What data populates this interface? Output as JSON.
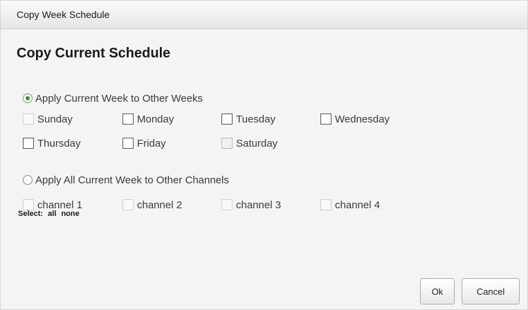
{
  "dialog": {
    "title": "Copy Week Schedule",
    "heading": "Copy Current Schedule"
  },
  "option_weeks": {
    "label": "Apply Current Week to Other Weeks",
    "selected": true,
    "days": [
      {
        "label": "Sunday",
        "checked": false,
        "enabled": false
      },
      {
        "label": "Monday",
        "checked": false,
        "enabled": true
      },
      {
        "label": "Tuesday",
        "checked": false,
        "enabled": true
      },
      {
        "label": "Wednesday",
        "checked": false,
        "enabled": true
      },
      {
        "label": "Thursday",
        "checked": false,
        "enabled": true
      },
      {
        "label": "Friday",
        "checked": false,
        "enabled": true
      },
      {
        "label": "Saturday",
        "checked": false,
        "enabled": true
      }
    ]
  },
  "option_channels": {
    "label": "Apply All Current Week to Other Channels",
    "selected": false,
    "channels": [
      {
        "label": "channel 1",
        "checked": false,
        "enabled": false
      },
      {
        "label": "channel 2",
        "checked": false,
        "enabled": false
      },
      {
        "label": "channel 3",
        "checked": false,
        "enabled": false
      },
      {
        "label": "channel 4",
        "checked": false,
        "enabled": false
      }
    ]
  },
  "select": {
    "label": "Select:",
    "all": "all",
    "none": "none"
  },
  "buttons": {
    "ok": "Ok",
    "cancel": "Cancel"
  }
}
